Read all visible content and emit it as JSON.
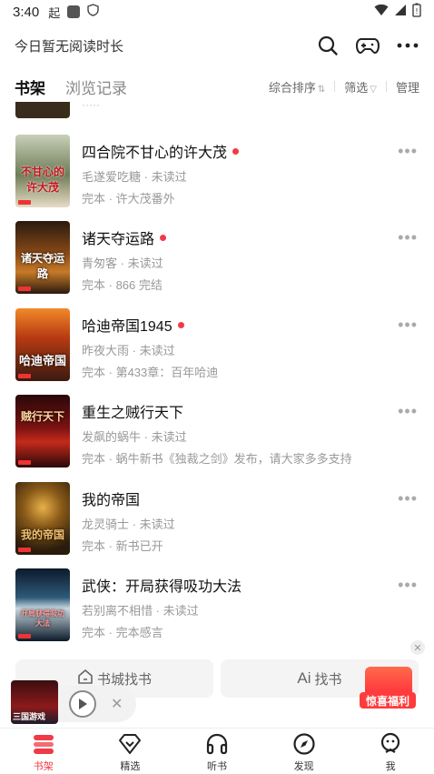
{
  "status_bar": {
    "time": "3:40",
    "left_glyph": "起"
  },
  "header": {
    "reading_time": "今日暂无阅读时长"
  },
  "tabs": [
    {
      "label": "书架",
      "active": true
    },
    {
      "label": "浏览记录",
      "active": false
    }
  ],
  "tools": {
    "sort": "综合排序",
    "filter": "筛选",
    "manage": "管理"
  },
  "books": [
    {
      "title": "四合院不甘心的许大茂",
      "author": "毛遂爱吃糖",
      "read_status": "未读过",
      "status": "完本",
      "latest": "许大茂番外",
      "new_dot": true,
      "cover_text": "不甘心的许大茂",
      "cover_color": "#8a9a6a"
    },
    {
      "title": "诸天夺运路",
      "author": "青匆客",
      "read_status": "未读过",
      "status": "完本",
      "latest": "866 完结",
      "new_dot": true,
      "cover_text": "诸天夺运路",
      "cover_color": "#7a4b1c"
    },
    {
      "title": "哈迪帝国1945",
      "author": "昨夜大雨",
      "read_status": "未读过",
      "status": "完本",
      "latest": "第433章：百年哈迪",
      "new_dot": true,
      "cover_text": "哈迪帝国",
      "cover_color": "#a83a1a"
    },
    {
      "title": "重生之贼行天下",
      "author": "发飙的蜗牛",
      "read_status": "未读过",
      "status": "完本",
      "latest": "蜗牛新书《独裁之剑》发布，请大家多多支持",
      "new_dot": false,
      "cover_text": "贼行天下",
      "cover_color": "#5a0f12"
    },
    {
      "title": "我的帝国",
      "author": "龙灵骑士",
      "read_status": "未读过",
      "status": "完本",
      "latest": "新书已开",
      "new_dot": false,
      "cover_text": "我的帝国",
      "cover_color": "#5c3a10"
    },
    {
      "title": "武侠：开局获得吸功大法",
      "author": "若别离不相惜",
      "read_status": "未读过",
      "status": "完本",
      "latest": "完本感言",
      "new_dot": false,
      "cover_text": "开局获得吸功大法",
      "cover_color": "#1e3550"
    }
  ],
  "bottom_buttons": {
    "bookstore": "书城找书",
    "ai": "找书",
    "ai_prefix": "Ai"
  },
  "promo": {
    "label": "惊喜福利"
  },
  "player": {
    "cover_text": "三国游戏"
  },
  "nav": [
    {
      "label": "书架",
      "icon": "bookshelf-icon",
      "active": true
    },
    {
      "label": "精选",
      "icon": "diamond-icon",
      "active": false
    },
    {
      "label": "听书",
      "icon": "headphones-icon",
      "active": false
    },
    {
      "label": "发现",
      "icon": "compass-icon",
      "active": false
    },
    {
      "label": "我",
      "icon": "profile-icon",
      "active": false
    }
  ],
  "colors": {
    "accent": "#f03a46"
  }
}
